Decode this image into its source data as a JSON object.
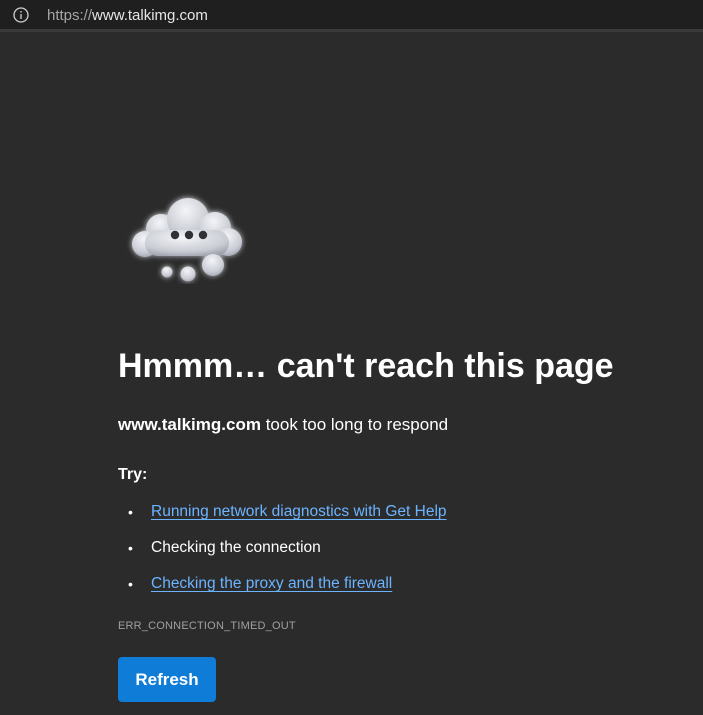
{
  "address_bar": {
    "info_icon": "info-circle-icon",
    "url_scheme": "https://",
    "url_host": "www.talkimg.com"
  },
  "error_page": {
    "illustration_icon": "thinking-cloud-icon",
    "headline": "Hmmm… can't reach this page",
    "host": "www.talkimg.com",
    "message": " took too long to respond",
    "try_label": "Try:",
    "suggestions": [
      {
        "text": "Running network diagnostics with Get Help",
        "is_link": true
      },
      {
        "text": "Checking the connection",
        "is_link": false
      },
      {
        "text": "Checking the proxy and the firewall",
        "is_link": true
      }
    ],
    "error_code": "ERR_CONNECTION_TIMED_OUT",
    "refresh_label": "Refresh"
  },
  "colors": {
    "background": "#2b2b2b",
    "link": "#6cb4ff",
    "button": "#0f7dd8"
  }
}
